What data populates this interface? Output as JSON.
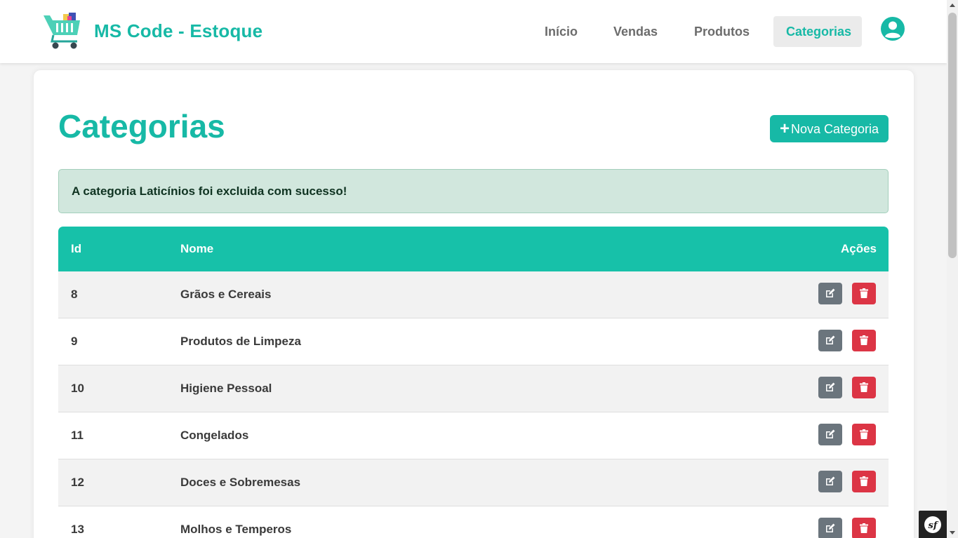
{
  "brand": {
    "name": "MS Code - Estoque",
    "logo_icon": "shopping-cart-icon"
  },
  "nav": {
    "items": [
      {
        "label": "Início",
        "active": false
      },
      {
        "label": "Vendas",
        "active": false
      },
      {
        "label": "Produtos",
        "active": false
      },
      {
        "label": "Categorias",
        "active": true
      }
    ],
    "user_icon": "user-circle-icon"
  },
  "page": {
    "title": "Categorias",
    "new_button": {
      "icon": "plus",
      "label": "Nova Categoria"
    },
    "alert": "A categoria Laticínios foi excluida com sucesso!"
  },
  "table": {
    "headers": {
      "id": "Id",
      "name": "Nome",
      "actions": "Ações"
    },
    "rows": [
      {
        "id": "8",
        "name": "Grãos e Cereais"
      },
      {
        "id": "9",
        "name": "Produtos de Limpeza"
      },
      {
        "id": "10",
        "name": "Higiene Pessoal"
      },
      {
        "id": "11",
        "name": "Congelados"
      },
      {
        "id": "12",
        "name": "Doces e Sobremesas"
      },
      {
        "id": "13",
        "name": "Molhos e Temperos"
      }
    ],
    "row_actions": [
      "edit-icon",
      "trash-icon"
    ]
  },
  "colors": {
    "accent": "#17b9a6",
    "header": "#17c1a9",
    "edit": "#6b757d",
    "delete": "#dc3545",
    "alert_bg": "#d1e7dd"
  },
  "debug_toolbar_icon": "symfony-icon"
}
